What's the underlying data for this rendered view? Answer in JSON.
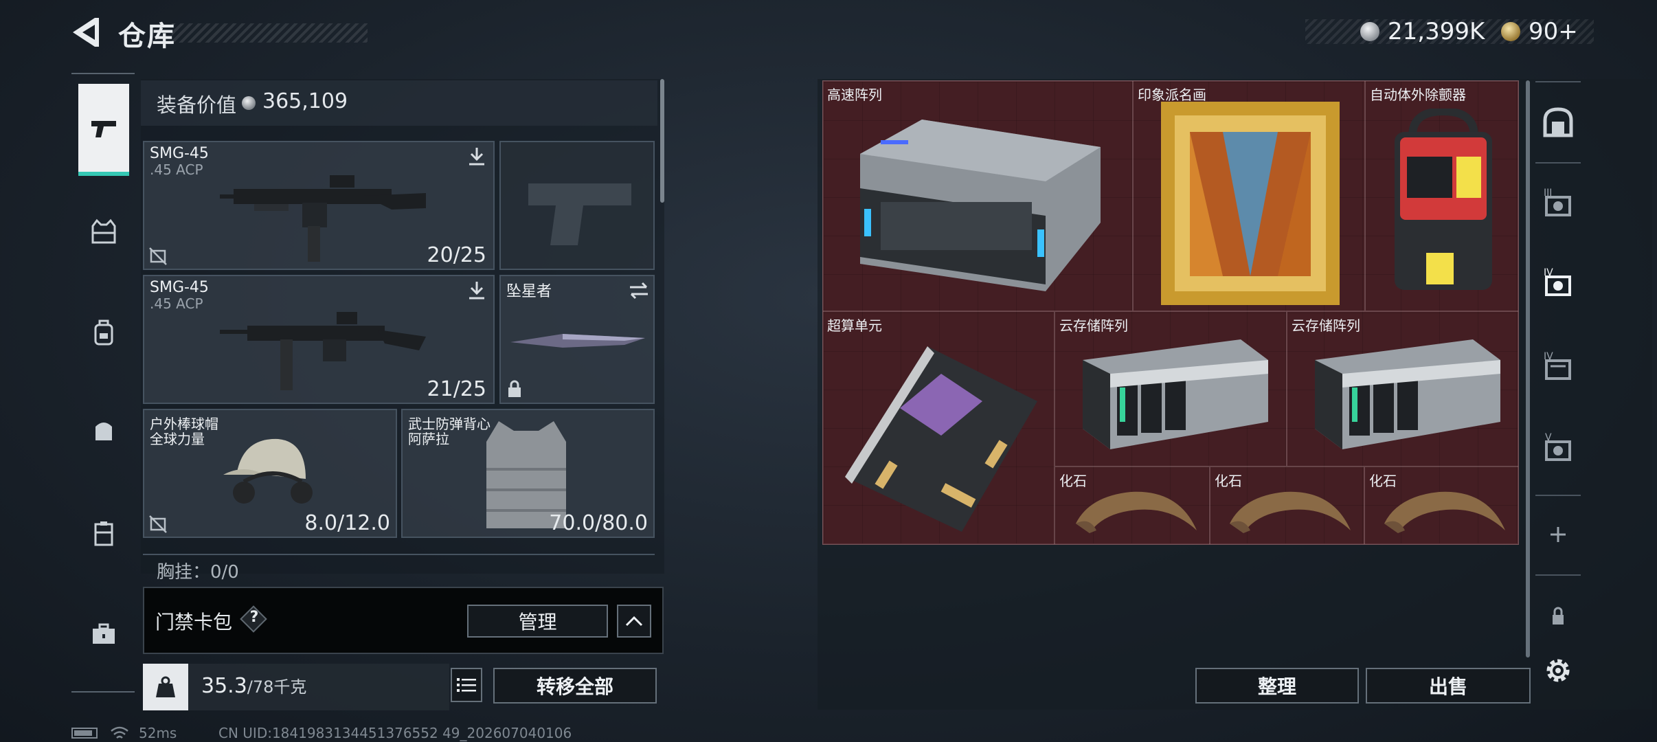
{
  "header": {
    "title": "仓库",
    "silver_amount": "21,399K",
    "gold_amount": "90+"
  },
  "equipment": {
    "label": "装备价值",
    "value": "365,109",
    "slots": [
      {
        "name": "SMG-45",
        "ammo": ".45 ACP",
        "count": "20/25"
      },
      {
        "name": "SMG-45",
        "ammo": ".45 ACP",
        "count": "21/25"
      },
      {
        "name": "坠星者"
      },
      {
        "name": "户外棒球帽",
        "sub": "全球力量",
        "count": "8.0/12.0"
      },
      {
        "name": "武士防弹背心",
        "sub": "阿萨拉",
        "count": "70.0/80.0"
      }
    ],
    "chest_label": "胸挂：0/0"
  },
  "keycard": {
    "label": "门禁卡包",
    "help": "?",
    "manage": "管理"
  },
  "weight": {
    "current": "35.3",
    "max": "/78千克"
  },
  "transfer_all": "转移全部",
  "status": {
    "ping": "52ms",
    "uid": "CN UID:1841983134451376552 49_202607040106"
  },
  "container": {
    "items": [
      {
        "label": "高速阵列"
      },
      {
        "label": "印象派名画"
      },
      {
        "label": "自动体外除颤器"
      },
      {
        "label": "超算单元"
      },
      {
        "label": "云存储阵列"
      },
      {
        "label": "云存储阵列"
      },
      {
        "label": "化石"
      },
      {
        "label": "化石"
      },
      {
        "label": "化石"
      }
    ]
  },
  "side_tabs": [
    "III",
    "IV",
    "IV",
    "V"
  ],
  "actions": {
    "sort": "整理",
    "sell": "出售"
  },
  "colors": {
    "accent": "#35c8b4",
    "container_bg": "#3a1a1e"
  }
}
